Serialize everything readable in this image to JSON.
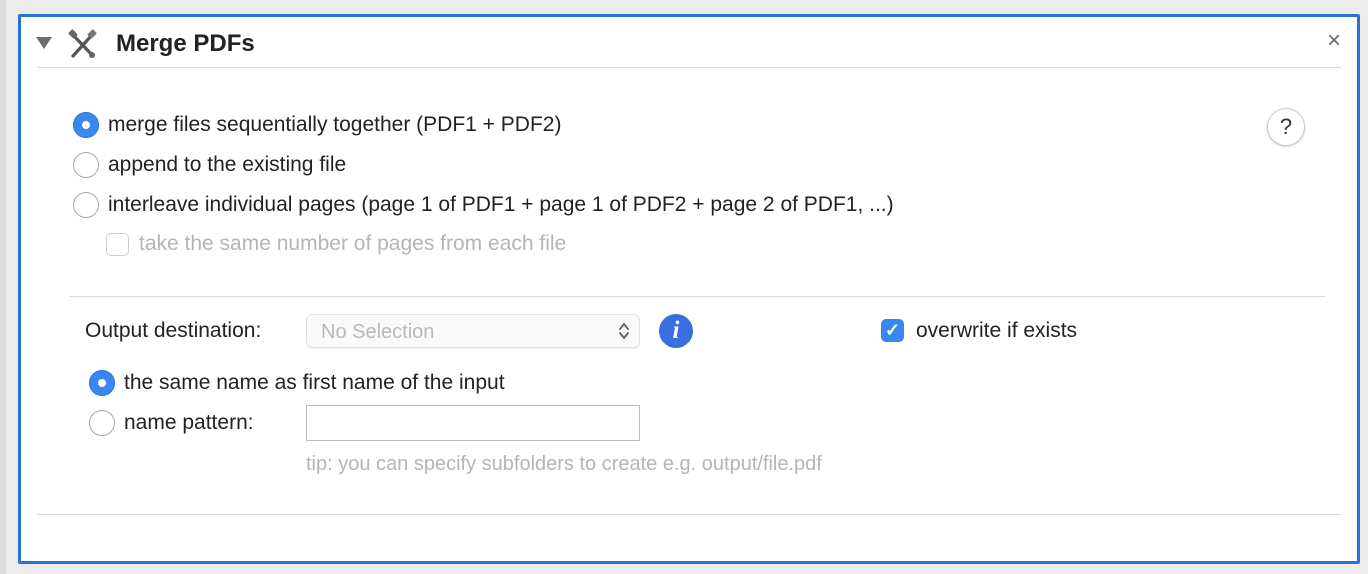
{
  "action": {
    "title": "Merge PDFs",
    "icon": "tools-icon",
    "close_glyph": "×"
  },
  "merge_mode": {
    "options": [
      {
        "label": "merge files sequentially together (PDF1 + PDF2)",
        "selected": true
      },
      {
        "label": "append to the existing file",
        "selected": false
      },
      {
        "label": "interleave individual pages (page 1 of PDF1 + page 1 of PDF2 + page 2 of PDF1, ...)",
        "selected": false
      }
    ],
    "same_pages_checkbox": {
      "label": "take the same number of pages from each file",
      "checked": false,
      "enabled": false
    }
  },
  "help": {
    "glyph": "?"
  },
  "output": {
    "destination_label": "Output destination:",
    "destination_value": "No Selection",
    "info_glyph": "i",
    "overwrite": {
      "label": "overwrite if exists",
      "checked": true
    },
    "naming_options": [
      {
        "label": "the same name as first name of the input",
        "selected": true
      },
      {
        "label": "name pattern:",
        "selected": false
      }
    ],
    "name_pattern_value": "",
    "tip": "tip: you can specify subfolders to create e.g. output/file.pdf"
  },
  "colors": {
    "accent": "#3b87f0",
    "focus_border": "#2a72d6",
    "info_button": "#3a6ee0",
    "disabled_text": "#b5b5b5"
  }
}
